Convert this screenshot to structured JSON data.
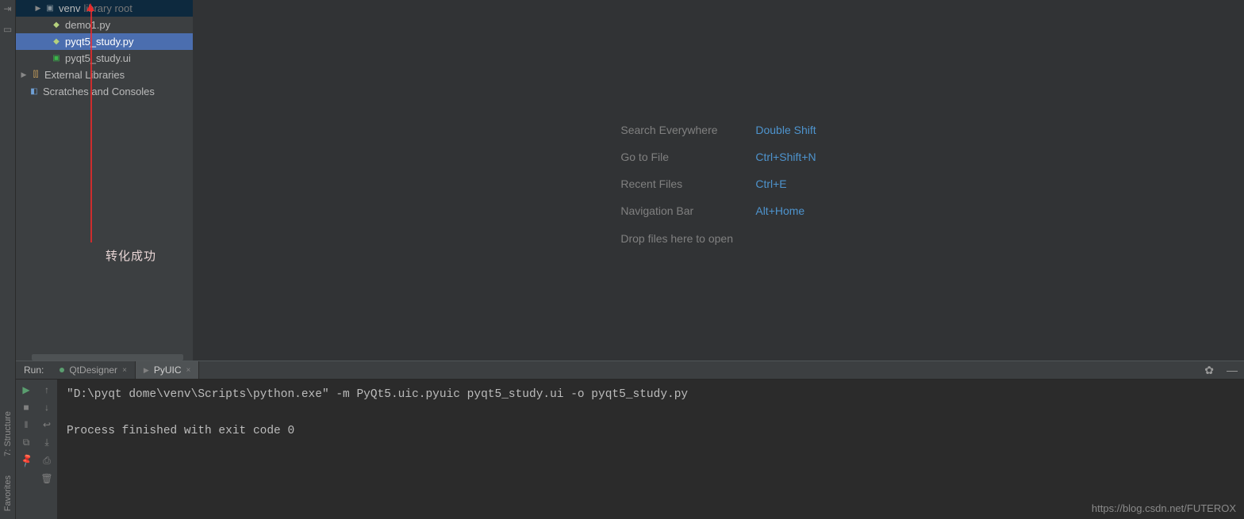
{
  "tree": {
    "venv": {
      "label": "venv",
      "suffix": "library root"
    },
    "files": [
      {
        "name": "demo1.py",
        "type": "py",
        "sel": false
      },
      {
        "name": "pyqt5_study.py",
        "type": "py",
        "sel": true
      },
      {
        "name": "pyqt5_study.ui",
        "type": "qt",
        "sel": false
      }
    ],
    "ext_lib": "External Libraries",
    "scratches": "Scratches and Consoles"
  },
  "hints": [
    {
      "label": "Search Everywhere",
      "key": "Double Shift"
    },
    {
      "label": "Go to File",
      "key": "Ctrl+Shift+N"
    },
    {
      "label": "Recent Files",
      "key": "Ctrl+E"
    },
    {
      "label": "Navigation Bar",
      "key": "Alt+Home"
    }
  ],
  "drop_hint": "Drop files here to open",
  "annotation": "转化成功",
  "run": {
    "title": "Run:",
    "tabs": [
      {
        "label": "QtDesigner",
        "active": false
      },
      {
        "label": "PyUIC",
        "active": true
      }
    ],
    "console_line1": "\"D:\\pyqt dome\\venv\\Scripts\\python.exe\" -m PyQt5.uic.pyuic pyqt5_study.ui -o pyqt5_study.py",
    "console_line2": "Process finished with exit code 0"
  },
  "gutter": {
    "structure": "7: Structure",
    "favorites": "Favorites"
  },
  "watermark": "https://blog.csdn.net/FUTEROX"
}
